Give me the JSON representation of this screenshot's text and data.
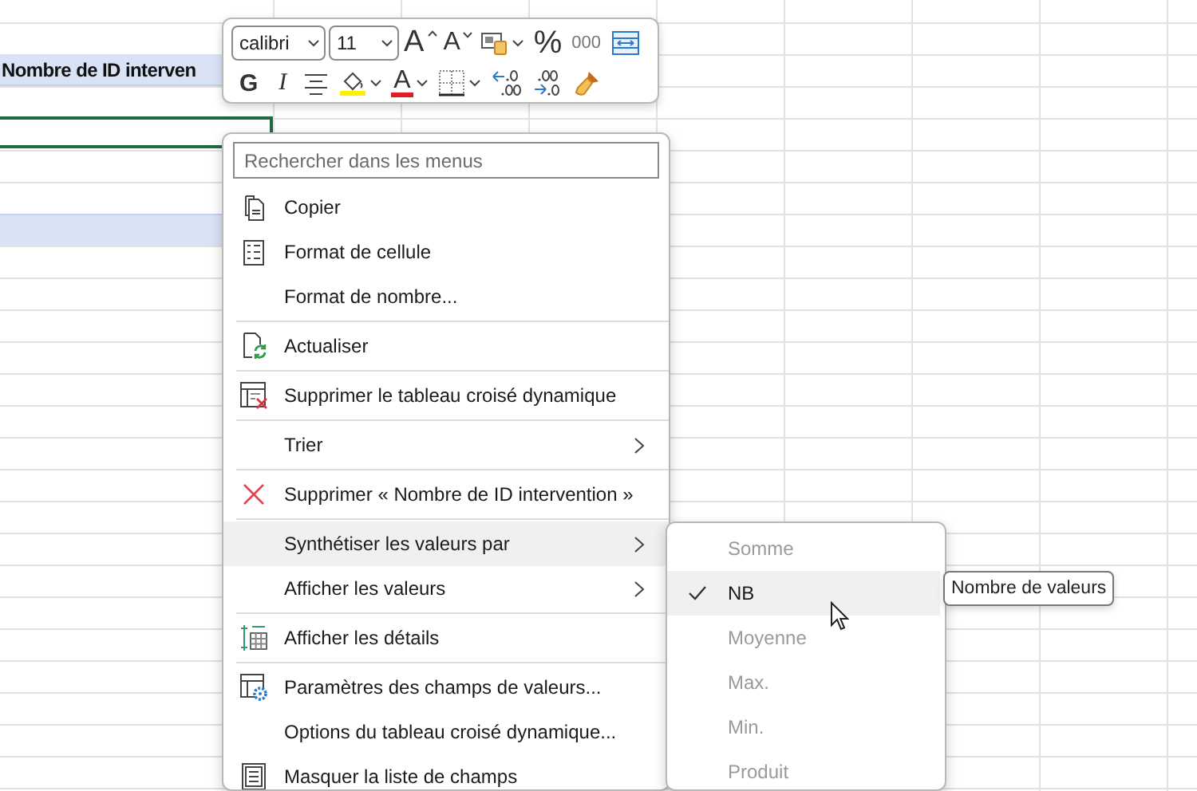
{
  "sheet": {
    "header_cell": "Nombre de ID interven"
  },
  "toolbar": {
    "font": "calibri",
    "size": "11",
    "row1": [
      {
        "kind": "grow",
        "label": "A"
      },
      {
        "kind": "shrink",
        "label": "A"
      },
      {
        "kind": "styles"
      },
      {
        "kind": "percent",
        "label": "%"
      },
      {
        "kind": "thousands",
        "label": "000"
      },
      {
        "kind": "wrap"
      }
    ],
    "row2": [
      {
        "kind": "bold",
        "label": "G"
      },
      {
        "kind": "italic",
        "label": "I"
      },
      {
        "kind": "align"
      },
      {
        "kind": "fill"
      },
      {
        "kind": "fontcolor",
        "label": "A"
      },
      {
        "kind": "borders"
      },
      {
        "kind": "inc-decimal"
      },
      {
        "kind": "dec-decimal"
      },
      {
        "kind": "painter"
      }
    ]
  },
  "context_menu": {
    "search": {
      "placeholder": "Rechercher dans les menus"
    },
    "items": [
      {
        "kind": "command",
        "label": "Copier",
        "selected": false
      },
      {
        "kind": "command",
        "label": "Format de cellule",
        "selected": false
      },
      {
        "kind": "command",
        "label": "Format de nombre...",
        "selected": false
      },
      {
        "kind": "separator"
      },
      {
        "kind": "command",
        "label": "Actualiser",
        "selected": false
      },
      {
        "kind": "separator"
      },
      {
        "kind": "command",
        "label": "Supprimer le tableau croisé dynamique",
        "selected": false
      },
      {
        "kind": "separator"
      },
      {
        "kind": "submenu",
        "label": "Trier",
        "selected": false
      },
      {
        "kind": "separator"
      },
      {
        "kind": "command",
        "label": "Supprimer « Nombre de ID intervention »",
        "selected": false
      },
      {
        "kind": "separator"
      },
      {
        "kind": "submenu",
        "label": "Synthétiser les valeurs par",
        "selected": true
      },
      {
        "kind": "submenu",
        "label": "Afficher les valeurs",
        "selected": false
      },
      {
        "kind": "separator"
      },
      {
        "kind": "command",
        "label": "Afficher les détails",
        "selected": false
      },
      {
        "kind": "separator"
      },
      {
        "kind": "command",
        "label": "Paramètres des champs de valeurs...",
        "selected": false
      },
      {
        "kind": "command",
        "label": "Options du tableau croisé dynamique...",
        "selected": false
      },
      {
        "kind": "command",
        "label": "Masquer la liste de champs",
        "selected": false
      }
    ]
  },
  "submenu": {
    "items": [
      {
        "label": "Somme",
        "checked": false,
        "disabled": true,
        "selected": false
      },
      {
        "label": "NB",
        "checked": true,
        "disabled": false,
        "selected": true
      },
      {
        "label": "Moyenne",
        "checked": false,
        "disabled": true,
        "selected": false
      },
      {
        "label": "Max.",
        "checked": false,
        "disabled": true,
        "selected": false
      },
      {
        "label": "Min.",
        "checked": false,
        "disabled": true,
        "selected": false
      },
      {
        "label": "Produit",
        "checked": false,
        "disabled": true,
        "selected": false
      }
    ]
  },
  "tooltip": {
    "text": "Nombre de valeurs"
  }
}
